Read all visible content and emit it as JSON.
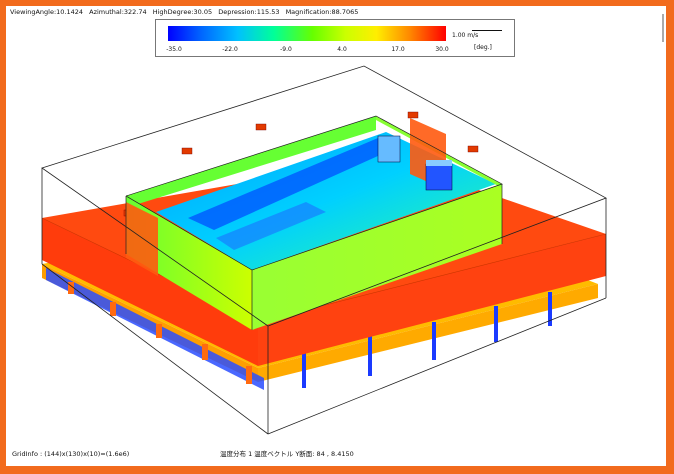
{
  "top_status": [
    "ViewingAngle:10.1424",
    "Azimuthal:322.74",
    "HighDegree:30.05",
    "Depression:115.53",
    "Magnification:88.7065"
  ],
  "legend": {
    "ticks": [
      "-35.0",
      "-22.0",
      "-9.0",
      "4.0",
      "17.0",
      "30.0"
    ],
    "vector_label": "1.00 m/s",
    "unit": "[deg.]"
  },
  "bottom_status": {
    "left": "GridInfo : (144)x(130)x(10)=(1.6e6)",
    "right": "温度分布 1 温度ベクトル Y断面: 84 , 8.4150"
  },
  "colors": {
    "floor_orange": "#ff4a10",
    "basement_yellow": "#ffbb00",
    "box_green": "#99ff33",
    "columns_blue": "#1a3aff"
  }
}
